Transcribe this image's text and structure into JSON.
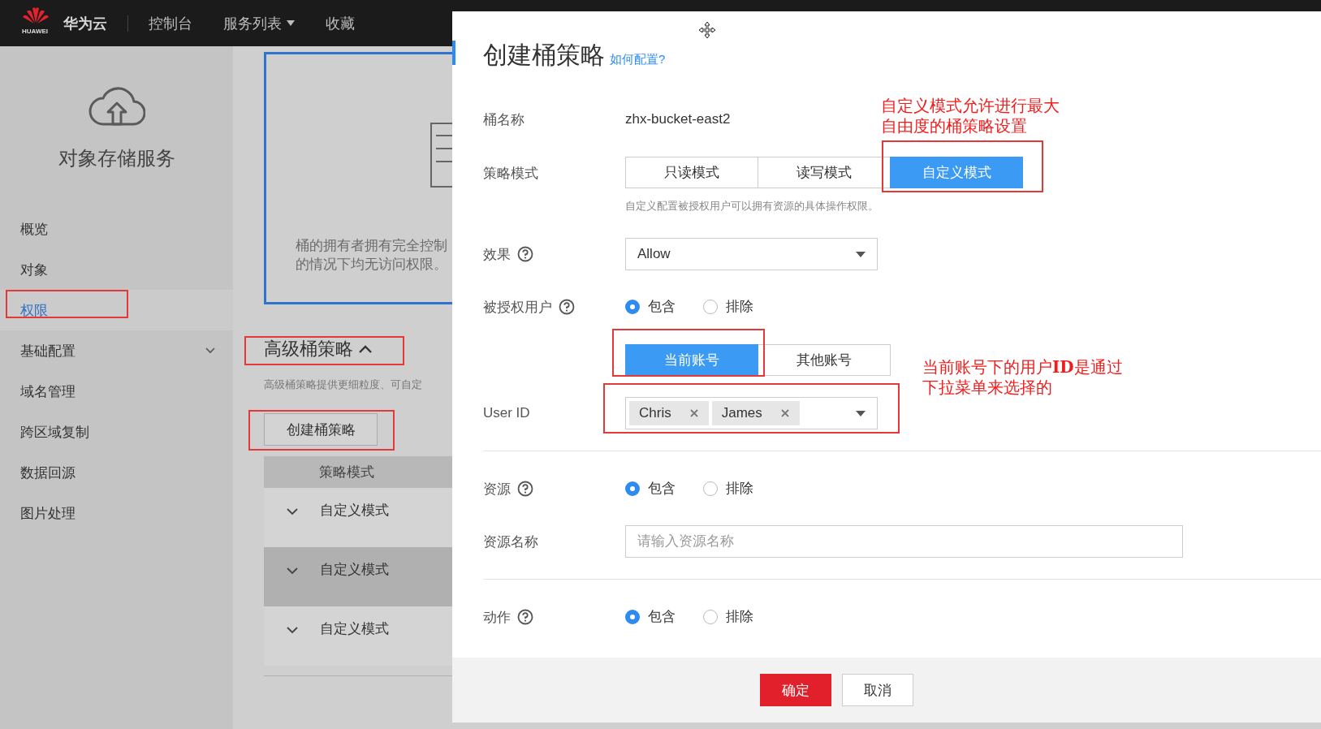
{
  "top_bar": {
    "logo_text": "HUAWEI",
    "brand": "华为云",
    "nav": [
      {
        "label": "控制台",
        "dropdown": false
      },
      {
        "label": "服务列表",
        "dropdown": true
      },
      {
        "label": "收藏",
        "dropdown": false
      }
    ]
  },
  "sidebar": {
    "title": "对象存储服务",
    "items": [
      {
        "label": "概览",
        "selected": false,
        "expandable": false
      },
      {
        "label": "对象",
        "selected": false,
        "expandable": false
      },
      {
        "label": "权限",
        "selected": true,
        "expandable": false
      },
      {
        "label": "基础配置",
        "selected": false,
        "expandable": true
      },
      {
        "label": "域名管理",
        "selected": false,
        "expandable": false
      },
      {
        "label": "跨区域复制",
        "selected": false,
        "expandable": false
      },
      {
        "label": "数据回源",
        "selected": false,
        "expandable": false
      },
      {
        "label": "图片处理",
        "selected": false,
        "expandable": false
      }
    ]
  },
  "content": {
    "card": {
      "description_lines": [
        "桶的拥有者拥有完全控制",
        "的情况下均无访问权限。"
      ]
    },
    "section": {
      "title": "高级桶策略",
      "expanded": true,
      "description": "高级桶策略提供更细粒度、可自定",
      "create_button": "创建桶策略",
      "table": {
        "columns": [
          "策略模式"
        ],
        "rows": [
          {
            "mode": "自定义模式",
            "expanded": false,
            "hovered": false
          },
          {
            "mode": "自定义模式",
            "expanded": false,
            "hovered": true
          },
          {
            "mode": "自定义模式",
            "expanded": false,
            "hovered": false
          }
        ]
      }
    }
  },
  "dialog": {
    "title": "创建桶策略",
    "help_link": "如何配置?",
    "fields": [
      {
        "kind": "text",
        "label": "桶名称",
        "value": "zhx-bucket-east2"
      },
      {
        "kind": "segmented",
        "label": "策略模式",
        "options": [
          {
            "label": "只读模式",
            "selected": false
          },
          {
            "label": "读写模式",
            "selected": false
          },
          {
            "label": "自定义模式",
            "selected": true
          }
        ],
        "hint": "自定义配置被授权用户可以拥有资源的具体操作权限。"
      },
      {
        "kind": "select",
        "label": "效果",
        "help": true,
        "value": "Allow"
      },
      {
        "kind": "radio",
        "label": "被授权用户",
        "help": true,
        "options": [
          {
            "label": "包含",
            "selected": true
          },
          {
            "label": "排除",
            "selected": false
          }
        ]
      },
      {
        "kind": "segmented",
        "options": [
          {
            "label": "当前账号",
            "selected": true
          },
          {
            "label": "其他账号",
            "selected": false
          }
        ]
      },
      {
        "kind": "tags",
        "label": "User ID",
        "tags": [
          "Chris",
          "James"
        ],
        "section_end": true
      },
      {
        "kind": "radio",
        "label": "资源",
        "help": true,
        "options": [
          {
            "label": "包含",
            "selected": true
          },
          {
            "label": "排除",
            "selected": false
          }
        ]
      },
      {
        "kind": "input",
        "label": "资源名称",
        "placeholder": "请输入资源名称",
        "section_end": true
      },
      {
        "kind": "radio",
        "label": "动作",
        "help": true,
        "options": [
          {
            "label": "包含",
            "selected": true
          },
          {
            "label": "排除",
            "selected": false
          }
        ]
      }
    ],
    "buttons": [
      {
        "label": "确定",
        "primary": true
      },
      {
        "label": "取消",
        "primary": false
      }
    ]
  },
  "annotations": [
    {
      "lines": [
        "自定义模式允许进行最大",
        "自由度的桶策略设置"
      ]
    },
    {
      "lines": [
        "当前账号下的用户**ID**是通过",
        "下拉菜单来选择的"
      ]
    }
  ]
}
